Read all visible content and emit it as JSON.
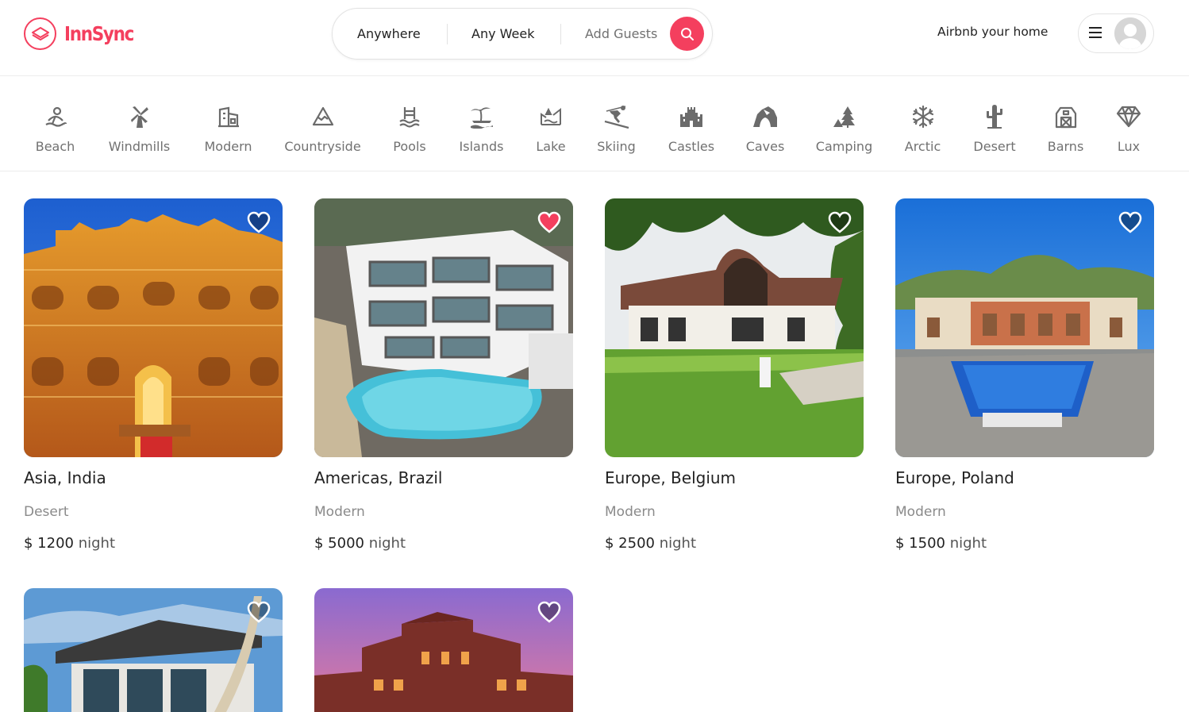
{
  "brand": {
    "name": "InnSync",
    "color": "#f43f5e"
  },
  "search": {
    "where": "Anywhere",
    "when": "Any Week",
    "who": "Add Guests",
    "search_icon": "search-icon"
  },
  "header": {
    "host_link": "Airbnb your home",
    "menu_icon": "hamburger-menu-icon",
    "avatar_icon": "user-avatar-icon"
  },
  "categories": [
    {
      "label": "Beach",
      "icon": "beach-icon"
    },
    {
      "label": "Windmills",
      "icon": "windmill-icon"
    },
    {
      "label": "Modern",
      "icon": "modern-building-icon"
    },
    {
      "label": "Countryside",
      "icon": "mountain-icon"
    },
    {
      "label": "Pools",
      "icon": "pool-icon"
    },
    {
      "label": "Islands",
      "icon": "island-icon"
    },
    {
      "label": "Lake",
      "icon": "lake-icon"
    },
    {
      "label": "Skiing",
      "icon": "skiing-icon"
    },
    {
      "label": "Castles",
      "icon": "castle-icon"
    },
    {
      "label": "Caves",
      "icon": "cave-icon"
    },
    {
      "label": "Camping",
      "icon": "camping-icon"
    },
    {
      "label": "Arctic",
      "icon": "snowflake-icon"
    },
    {
      "label": "Desert",
      "icon": "cactus-icon"
    },
    {
      "label": "Barns",
      "icon": "barn-icon"
    },
    {
      "label": "Lux",
      "icon": "diamond-icon"
    }
  ],
  "listings": [
    {
      "location": "Asia, India",
      "category": "Desert",
      "price": "$ 1200",
      "unit": "night",
      "favorited": false
    },
    {
      "location": "Americas, Brazil",
      "category": "Modern",
      "price": "$ 5000",
      "unit": "night",
      "favorited": true
    },
    {
      "location": "Europe, Belgium",
      "category": "Modern",
      "price": "$ 2500",
      "unit": "night",
      "favorited": false
    },
    {
      "location": "Europe, Poland",
      "category": "Modern",
      "price": "$ 1500",
      "unit": "night",
      "favorited": false
    },
    {
      "location": "",
      "category": "",
      "price": "",
      "unit": "",
      "favorited": false
    },
    {
      "location": "",
      "category": "",
      "price": "",
      "unit": "",
      "favorited": false
    }
  ]
}
